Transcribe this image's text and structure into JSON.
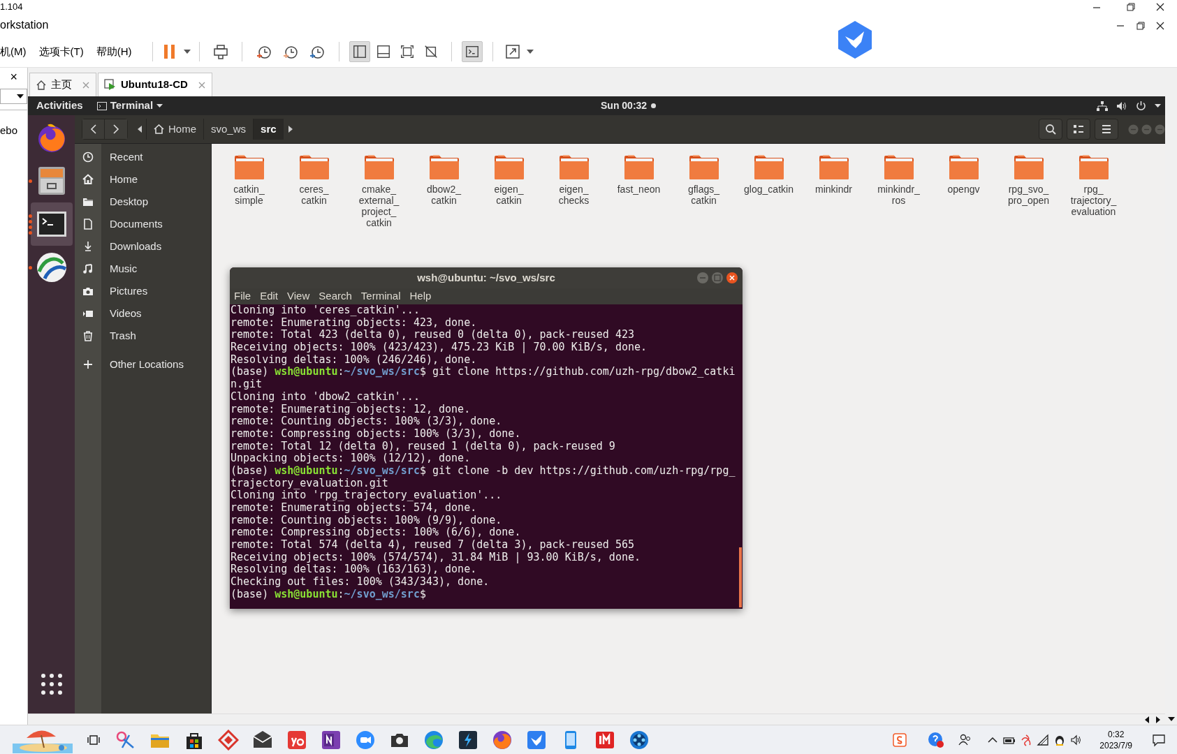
{
  "app_window": {
    "title_fragment": "1.104",
    "subtitle_fragment": "orkstation"
  },
  "menu": [
    "机(M)",
    "选项卡(T)",
    "帮助(H)"
  ],
  "toolbar_toggles": [
    {
      "pressed": true
    },
    {
      "pressed": false
    },
    {
      "pressed": false
    },
    {
      "pressed": false
    },
    {
      "pressed": true
    }
  ],
  "left_panel": {
    "close": "×",
    "text_fragment": "ebo"
  },
  "vm_tabs": [
    {
      "label": "主页",
      "selected": false
    },
    {
      "label": "Ubuntu18-CD",
      "selected": true
    }
  ],
  "ubuntu_top_bar": {
    "activities": "Activities",
    "app_menu": "Terminal",
    "clock": "Sun 00:32"
  },
  "dock": [
    {
      "running": false,
      "selected": false
    },
    {
      "running": true,
      "selected": false
    },
    {
      "running": true,
      "selected": true
    },
    {
      "running": true,
      "selected": false
    }
  ],
  "path_bar": [
    {
      "label": "Home",
      "selected": false
    },
    {
      "label": "svo_ws",
      "selected": false
    },
    {
      "label": "src",
      "selected": true
    }
  ],
  "sidebar": [
    {
      "label": "Recent"
    },
    {
      "label": "Home"
    },
    {
      "label": "Desktop"
    },
    {
      "label": "Documents"
    },
    {
      "label": "Downloads"
    },
    {
      "label": "Music"
    },
    {
      "label": "Pictures"
    },
    {
      "label": "Videos"
    },
    {
      "label": "Trash"
    },
    {
      "label": "Other Locations"
    }
  ],
  "folders": [
    "catkin_simple",
    "ceres_catkin",
    "cmake_external_project_catkin",
    "dbow2_catkin",
    "eigen_catkin",
    "eigen_checks",
    "fast_neon",
    "gflags_catkin",
    "glog_catkin",
    "minkindr",
    "minkindr_ros",
    "opengv",
    "rpg_svo_pro_open",
    "rpg_trajectory_evaluation"
  ],
  "terminal": {
    "title": "wsh@ubuntu: ~/svo_ws/src",
    "menu": [
      "File",
      "Edit",
      "View",
      "Search",
      "Terminal",
      "Help"
    ],
    "lines": [
      {
        "kind": "output",
        "text": "Cloning into 'ceres_catkin'..."
      },
      {
        "kind": "output",
        "text": "remote: Enumerating objects: 423, done."
      },
      {
        "kind": "output",
        "text": "remote: Total 423 (delta 0), reused 0 (delta 0), pack-reused 423"
      },
      {
        "kind": "output",
        "text": "Receiving objects: 100% (423/423), 475.23 KiB | 70.00 KiB/s, done."
      },
      {
        "kind": "output",
        "text": "Resolving deltas: 100% (246/246), done."
      },
      {
        "kind": "prompt",
        "env": "(base)",
        "user": "wsh@ubuntu",
        "sep": ":",
        "path": "~/svo_ws/src",
        "symbol": "$",
        "command": "git clone https://github.com/uzh-rpg/dbow2_catki"
      },
      {
        "kind": "output",
        "text": "n.git"
      },
      {
        "kind": "output",
        "text": "Cloning into 'dbow2_catkin'..."
      },
      {
        "kind": "output",
        "text": "remote: Enumerating objects: 12, done."
      },
      {
        "kind": "output",
        "text": "remote: Counting objects: 100% (3/3), done."
      },
      {
        "kind": "output",
        "text": "remote: Compressing objects: 100% (3/3), done."
      },
      {
        "kind": "output",
        "text": "remote: Total 12 (delta 0), reused 1 (delta 0), pack-reused 9"
      },
      {
        "kind": "output",
        "text": "Unpacking objects: 100% (12/12), done."
      },
      {
        "kind": "prompt",
        "env": "(base)",
        "user": "wsh@ubuntu",
        "sep": ":",
        "path": "~/svo_ws/src",
        "symbol": "$",
        "command": "git clone -b dev https://github.com/uzh-rpg/rpg_"
      },
      {
        "kind": "output",
        "text": "trajectory_evaluation.git"
      },
      {
        "kind": "output",
        "text": "Cloning into 'rpg_trajectory_evaluation'..."
      },
      {
        "kind": "output",
        "text": "remote: Enumerating objects: 574, done."
      },
      {
        "kind": "output",
        "text": "remote: Counting objects: 100% (9/9), done."
      },
      {
        "kind": "output",
        "text": "remote: Compressing objects: 100% (6/6), done."
      },
      {
        "kind": "output",
        "text": "remote: Total 574 (delta 4), reused 7 (delta 3), pack-reused 565"
      },
      {
        "kind": "output",
        "text": "Receiving objects: 100% (574/574), 31.84 MiB | 93.00 KiB/s, done."
      },
      {
        "kind": "output",
        "text": "Resolving deltas: 100% (163/163), done."
      },
      {
        "kind": "output",
        "text": "Checking out files: 100% (343/343), done."
      },
      {
        "kind": "prompt",
        "env": "(base)",
        "user": "wsh@ubuntu",
        "sep": ":",
        "path": "~/svo_ws/src",
        "symbol": "$"
      }
    ]
  },
  "taskbar": {
    "time": "0:32",
    "date": "2023/7/9"
  }
}
